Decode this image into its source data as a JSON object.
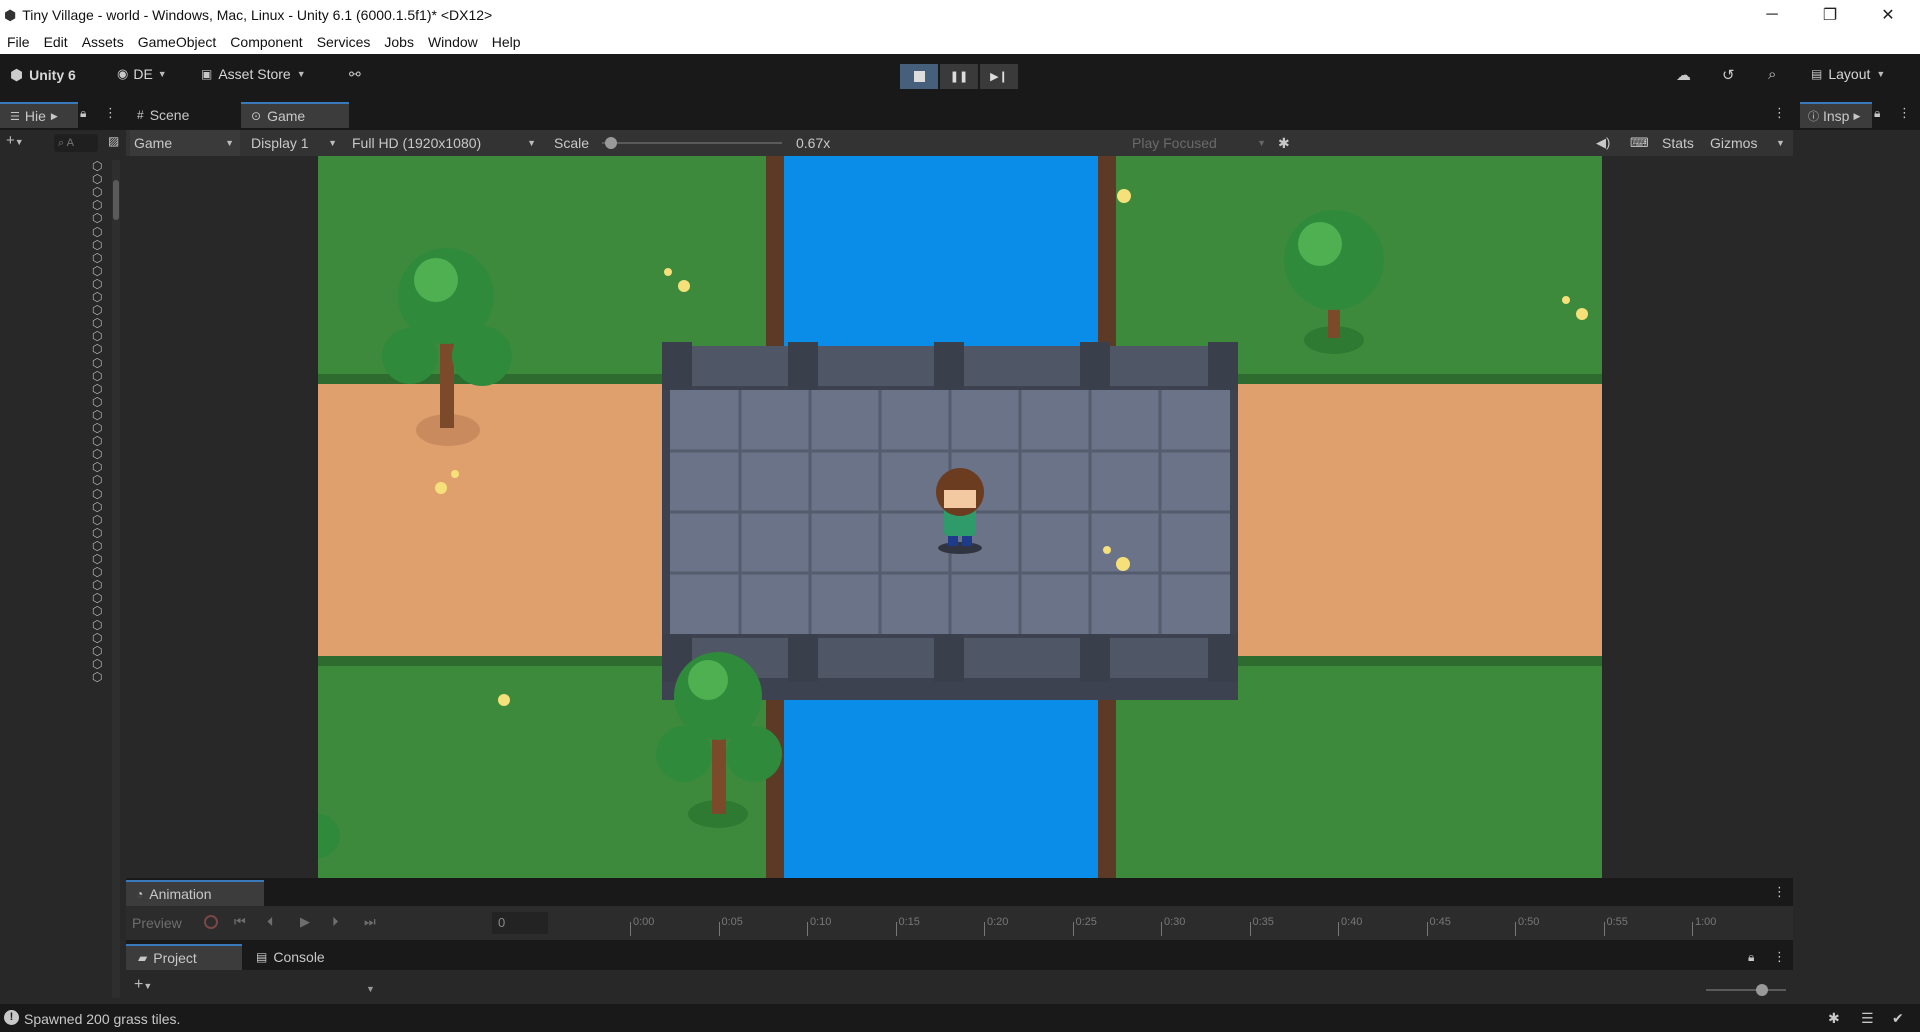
{
  "window": {
    "title": "Tiny Village - world - Windows, Mac, Linux - Unity 6.1 (6000.1.5f1)* <DX12>",
    "minimize": "─",
    "maximize": "❐",
    "close": "✕"
  },
  "menu": [
    "File",
    "Edit",
    "Assets",
    "GameObject",
    "Component",
    "Services",
    "Jobs",
    "Window",
    "Help"
  ],
  "toolbar": {
    "product": "Unity 6",
    "account": "DE",
    "asset_store": "Asset Store",
    "layout": "Layout"
  },
  "tabs": {
    "hierarchy": "Hie",
    "scene": "Scene",
    "game": "Game",
    "inspector": "Insp"
  },
  "game_toolbar": {
    "mode": "Game",
    "display": "Display 1",
    "resolution": "Full HD (1920x1080)",
    "scale_label": "Scale",
    "scale_value": "0.67x",
    "scale_fraction": 0.05,
    "play_mode": "Play Focused",
    "stats": "Stats",
    "gizmos": "Gizmos"
  },
  "hierarchy": {
    "search_placeholder": "A",
    "item_count": 40
  },
  "animation": {
    "tab": "Animation",
    "preview": "Preview",
    "frame": "0",
    "ticks": [
      "0:00",
      "0:05",
      "0:10",
      "0:15",
      "0:20",
      "0:25",
      "0:30",
      "0:35",
      "0:40",
      "0:45",
      "0:50",
      "0:55",
      "1:00"
    ]
  },
  "bottom_tabs": {
    "project": "Project",
    "console": "Console"
  },
  "status": {
    "message": "Spawned 200 grass tiles."
  },
  "colors": {
    "accent": "#3a79bb",
    "grass": "#3d8a3c",
    "dirt": "#e0a06e",
    "water": "#0a8de8",
    "stone": "#6a7387"
  }
}
